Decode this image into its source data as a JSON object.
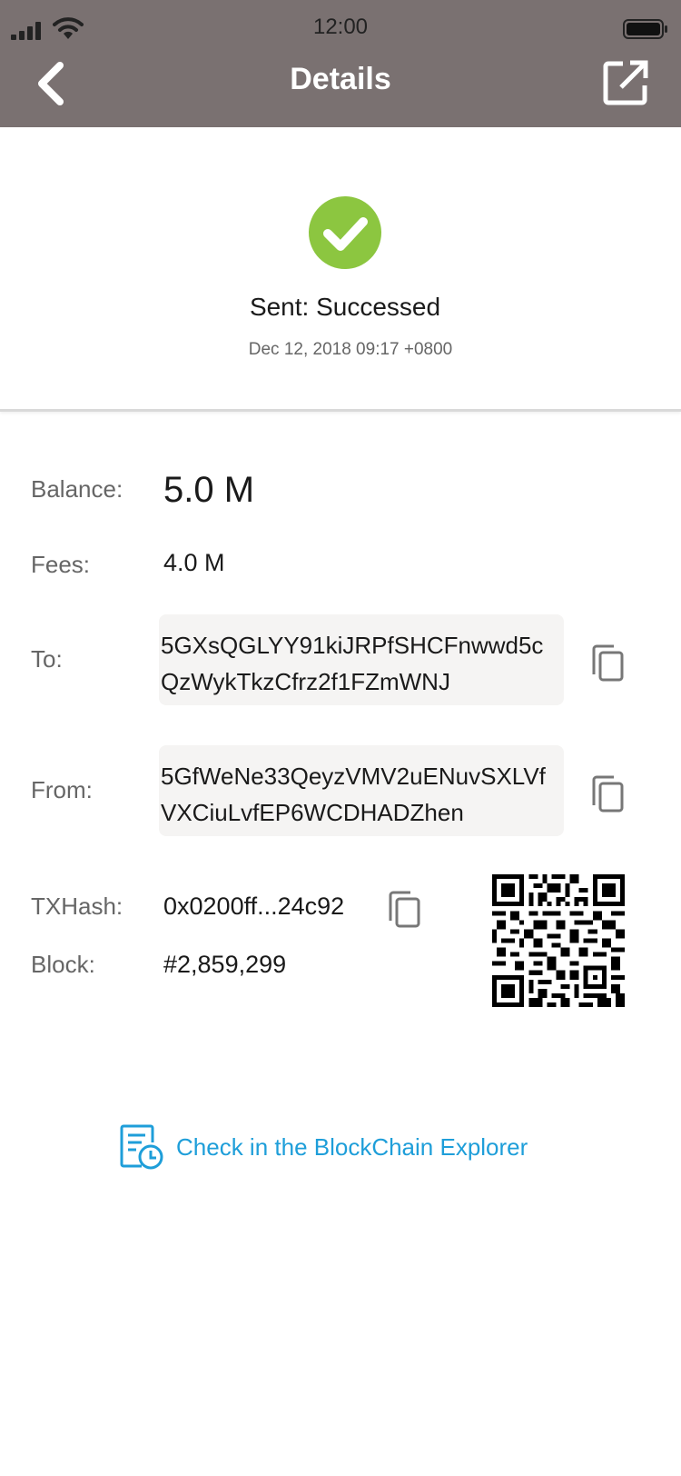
{
  "status_bar": {
    "time": "12:00",
    "signal_icon": "cellular-signal-icon",
    "wifi_icon": "wifi-icon",
    "battery_icon": "battery-icon"
  },
  "header": {
    "title": "Details",
    "back_icon": "chevron-left-icon",
    "share_icon": "external-link-icon",
    "background_color": "#7a7171"
  },
  "transaction_status": {
    "icon": "check-circle-icon",
    "icon_color": "#8cc640",
    "text": "Sent: Successed",
    "date": "Dec 12, 2018 09:17 +0800"
  },
  "details": {
    "balance_label": "Balance:",
    "balance_value": "5.0 M",
    "fees_label": "Fees:",
    "fees_value": "4.0 M",
    "to_label": "To:",
    "to_address": "5GXsQGLYY91kiJRPfSHCFnwwd5cQzWykTkzCfrz2f1FZmWNJ",
    "from_label": "From:",
    "from_address": "5GfWeNe33QeyzVMV2uENuvSXLVfVXCiuLvfEP6WCDHADZhen",
    "txhash_label": "TXHash:",
    "txhash_value": "0x0200ff...24c92",
    "block_label": "Block:",
    "block_value": "#2,859,299",
    "copy_icon": "copy-icon",
    "qr_icon": "qr-code-icon"
  },
  "explorer_link": {
    "label": "Check in the BlockChain Explorer",
    "icon": "document-clock-icon",
    "color": "#1e9ed9"
  }
}
